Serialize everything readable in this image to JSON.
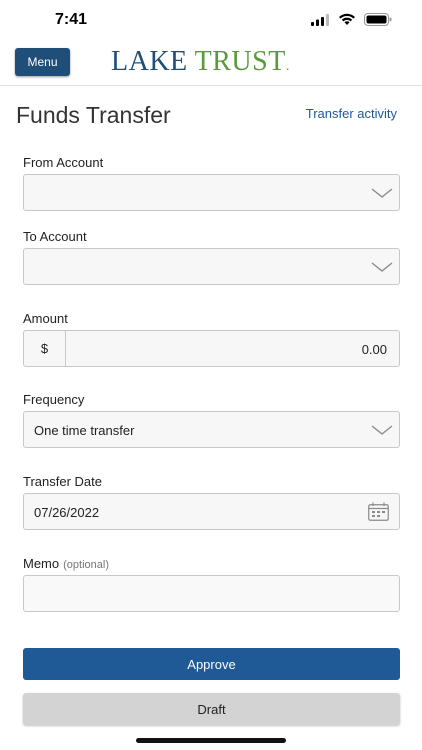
{
  "status_bar": {
    "time": "7:41"
  },
  "header": {
    "menu_label": "Menu",
    "logo_part1": "LAKE",
    "logo_part2": "TRUST",
    "logo_mark": "."
  },
  "page": {
    "title": "Funds Transfer",
    "activity_link": "Transfer activity"
  },
  "form": {
    "from_account": {
      "label": "From Account",
      "value": ""
    },
    "to_account": {
      "label": "To Account",
      "value": ""
    },
    "amount": {
      "label": "Amount",
      "prefix": "$",
      "value": "0.00"
    },
    "frequency": {
      "label": "Frequency",
      "value": "One time transfer"
    },
    "transfer_date": {
      "label": "Transfer Date",
      "value": "07/26/2022"
    },
    "memo": {
      "label": "Memo",
      "optional": "(optional)",
      "value": ""
    }
  },
  "actions": {
    "approve_label": "Approve",
    "draft_label": "Draft"
  },
  "colors": {
    "brand_blue": "#1f4e79",
    "brand_green": "#5a9a3c",
    "link_blue": "#1f5a96",
    "draft_gray": "#d3d3d3"
  },
  "icons": [
    "signal-icon",
    "wifi-icon",
    "battery-icon",
    "chevron-down-icon",
    "calendar-icon"
  ]
}
